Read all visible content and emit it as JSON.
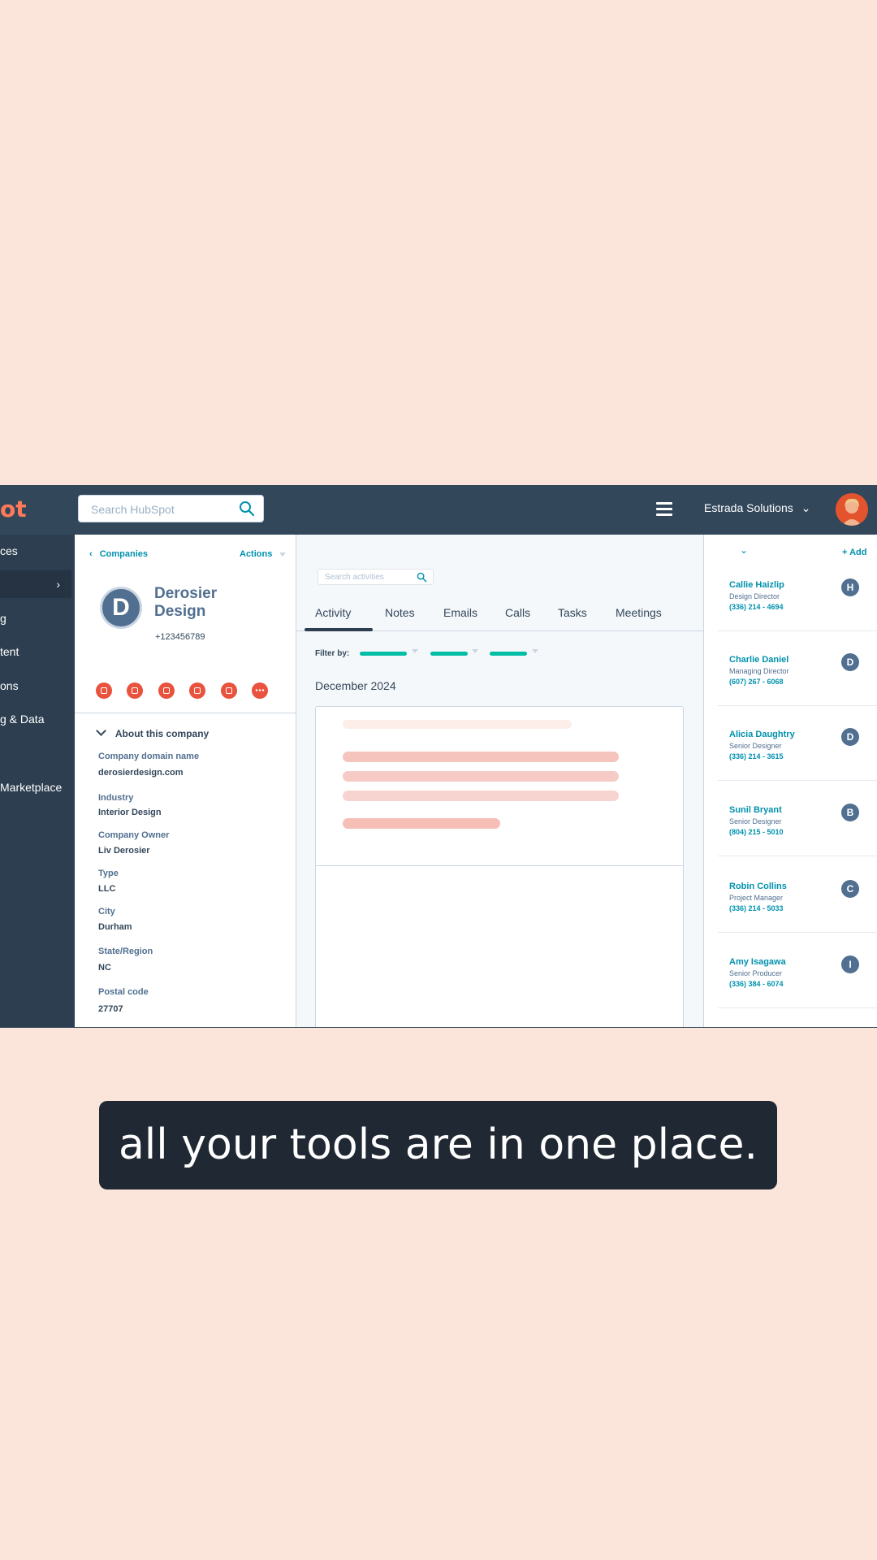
{
  "topbar": {
    "logo_fragment": "ot",
    "search_placeholder": "Search HubSpot",
    "account_name": "Estrada Solutions",
    "account_caret": "⌄"
  },
  "sidebar": {
    "items": [
      {
        "label": "ces"
      },
      {
        "label": "",
        "chevron": "›"
      },
      {
        "label": "g"
      },
      {
        "label": "tent"
      },
      {
        "label": "ons"
      },
      {
        "label": "g & Data"
      },
      {
        "label": "Marketplace"
      }
    ]
  },
  "company": {
    "breadcrumb": "Companies",
    "breadcrumb_caret": "‹",
    "actions_label": "Actions",
    "initial": "D",
    "name": "Derosier Design",
    "phone": "+123456789",
    "about_label": "About this company",
    "properties": [
      {
        "label": "Company domain name",
        "value": "derosierdesign.com"
      },
      {
        "label": "Industry",
        "value": "Interior Design"
      },
      {
        "label": "Company Owner",
        "value": "Liv Derosier"
      },
      {
        "label": "Type",
        "value": "LLC"
      },
      {
        "label": "City",
        "value": "Durham"
      },
      {
        "label": "State/Region",
        "value": "NC"
      },
      {
        "label": "Postal code",
        "value": "27707"
      }
    ]
  },
  "activity": {
    "search_placeholder": "Search activities",
    "tabs": [
      {
        "label": "Activity"
      },
      {
        "label": "Notes"
      },
      {
        "label": "Emails"
      },
      {
        "label": "Calls"
      },
      {
        "label": "Tasks"
      },
      {
        "label": "Meetings"
      }
    ],
    "filter_label": "Filter by:",
    "month": "December 2024"
  },
  "contacts": {
    "add_label": "+ Add",
    "chevron": "⌄",
    "items": [
      {
        "name": "Callie Haizlip",
        "role": "Design Director",
        "phone": "(336) 214 - 4694",
        "initial": "H"
      },
      {
        "name": "Charlie Daniel",
        "role": "Managing Director",
        "phone": "(607) 267 - 6068",
        "initial": "D"
      },
      {
        "name": "Alicia Daughtry",
        "role": "Senior Designer",
        "phone": "(336) 214 - 3615",
        "initial": "D"
      },
      {
        "name": "Sunil Bryant",
        "role": "Senior Designer",
        "phone": "(804) 215 - 5010",
        "initial": "B"
      },
      {
        "name": "Robin Collins",
        "role": "Project Manager",
        "phone": "(336) 214 - 5033",
        "initial": "C"
      },
      {
        "name": "Amy Isagawa",
        "role": "Senior Producer",
        "phone": "(336) 384 - 6074",
        "initial": "I"
      }
    ]
  },
  "caption": "all your tools are in one place.",
  "colors": {
    "topbar": "#33475b",
    "sidebar": "#2d3e50",
    "accent_teal": "#00bda5",
    "link": "#0091ae",
    "action_red": "#e9523d",
    "page_bg": "#fbe5da"
  }
}
